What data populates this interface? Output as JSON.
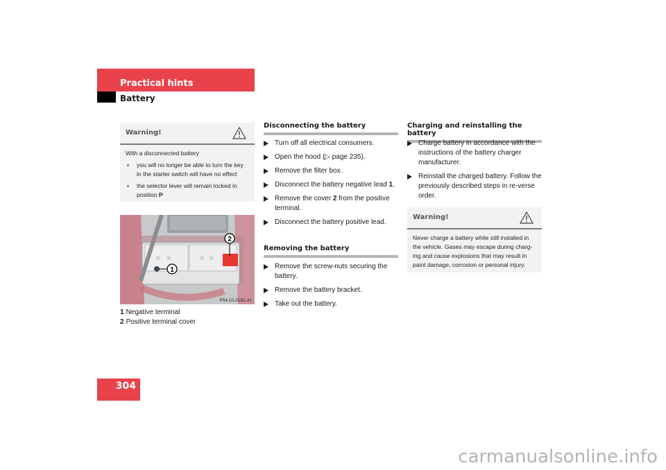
{
  "header": {
    "section": "Practical hints",
    "subsection": "Battery",
    "accent_color": "#e8434b"
  },
  "warning1": {
    "title": "Warning!",
    "icon": "warning-triangle-icon",
    "intro": "With a disconnected battery",
    "bullets": [
      "you will no longer be able to turn the key in the starter switch will have no effect",
      "the selector lever will remain locked in position "
    ],
    "bullet2_bold": "P"
  },
  "figure": {
    "callouts": [
      "1",
      "2"
    ],
    "code": "P54.10-2191-31",
    "legend": [
      {
        "num": "1",
        "label": "Negative terminal"
      },
      {
        "num": "2",
        "label": "Positive terminal cover"
      }
    ]
  },
  "disconnecting": {
    "heading": "Disconnecting the battery",
    "steps": [
      {
        "text": "Turn off all electrical consumers."
      },
      {
        "text": "Open the hood (▷ page 235)."
      },
      {
        "text": "Remove the filter box."
      },
      {
        "text": "Disconnect the battery negative lead ",
        "bold": "1",
        "after": "."
      },
      {
        "text": "Remove the cover ",
        "bold": "2",
        "after": " from the positive terminal."
      },
      {
        "text": "Disconnect the battery positive lead."
      }
    ]
  },
  "removing": {
    "heading": "Removing the battery",
    "steps": [
      "Remove the screw-nuts securing the battery.",
      "Remove the battery bracket.",
      "Take out the battery."
    ]
  },
  "charging": {
    "heading": "Charging and reinstalling the battery",
    "steps": [
      "Charge battery in accordance with the instructions of the battery charger manufacturer.",
      "Reinstall the charged battery. Follow the previously described steps in re-verse order."
    ]
  },
  "warning2": {
    "title": "Warning!",
    "icon": "warning-triangle-icon",
    "body": "Never charge a battery while still installed in the vehicle. Gases may escape during charg-ing and cause explosions that may result in paint damage, corrosion or personal injury."
  },
  "footer": {
    "page_number": "304",
    "watermark": "carmanualsonline.info"
  }
}
